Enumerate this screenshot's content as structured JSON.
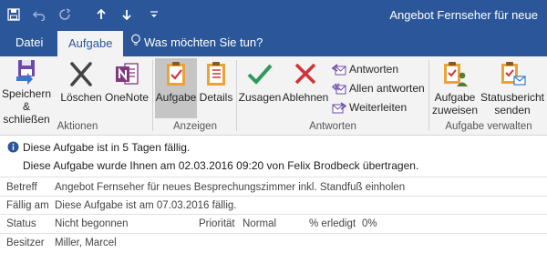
{
  "window": {
    "title": "Angebot Fernseher für neue"
  },
  "qat": {
    "save_icon": "save-icon",
    "undo_icon": "undo-icon",
    "redo_icon": "redo-icon",
    "up_icon": "arrow-up-icon",
    "down_icon": "arrow-down-icon",
    "more_icon": "customize-icon"
  },
  "tabs": [
    {
      "label": "Datei"
    },
    {
      "label": "Aufgabe"
    }
  ],
  "tell_me": {
    "label": "Was möchten Sie tun?"
  },
  "ribbon": {
    "groups": {
      "actions": "Aktionen",
      "show": "Anzeigen",
      "responses": "Antworten",
      "manage": "Aufgabe verwalten"
    },
    "buttons": {
      "save_close_1": "Speichern",
      "save_close_2": "& schließen",
      "delete": "Löschen",
      "onenote": "OneNote",
      "task": "Aufgabe",
      "details": "Details",
      "accept": "Zusagen",
      "decline": "Ablehnen",
      "reply": "Antworten",
      "reply_all": "Allen antworten",
      "forward": "Weiterleiten",
      "assign_1": "Aufgabe",
      "assign_2": "zuweisen",
      "status_1": "Statusbericht",
      "status_2": "senden"
    }
  },
  "info": {
    "line1": "Diese Aufgabe ist in 5 Tagen fällig.",
    "line2": "Diese Aufgabe wurde Ihnen am 02.03.2016 09:20 von Felix Brodbeck übertragen."
  },
  "fields": {
    "subject_label": "Betreff",
    "subject_value": "Angebot Fernseher für neues Besprechungszimmer inkl. Standfuß einholen",
    "due_label": "Fällig am",
    "due_value": "Diese Aufgabe ist am 07.03.2016 fällig.",
    "status_label": "Status",
    "status_value": "Nicht begonnen",
    "priority_label": "Priorität",
    "priority_value": "Normal",
    "percent_label": "% erledigt",
    "percent_value": "0%",
    "owner_label": "Besitzer",
    "owner_value": "Miller, Marcel"
  },
  "colors": {
    "brand": "#2b579a",
    "accept": "#2e9a5d",
    "decline": "#d13438",
    "onenote": "#80397b"
  }
}
